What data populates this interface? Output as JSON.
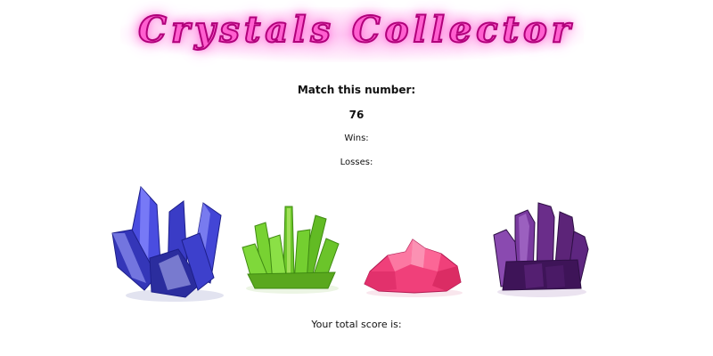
{
  "app": {
    "title": "Crystals Collector"
  },
  "game": {
    "match_prompt": "Match this number:",
    "target_number": "76",
    "wins_label": "Wins:",
    "losses_label": "Losses:",
    "total_score_label": "Your total score is:"
  },
  "crystals": [
    {
      "icon": "blue-crystal-icon",
      "color": "#3b3fcf"
    },
    {
      "icon": "green-crystal-icon",
      "color": "#6cc62a"
    },
    {
      "icon": "pink-crystal-icon",
      "color": "#f0407a"
    },
    {
      "icon": "purple-crystal-icon",
      "color": "#6a2d8a"
    }
  ],
  "colors": {
    "title": "#ff5fd0",
    "title_outline": "#b0007a",
    "background": "#ffffff"
  }
}
